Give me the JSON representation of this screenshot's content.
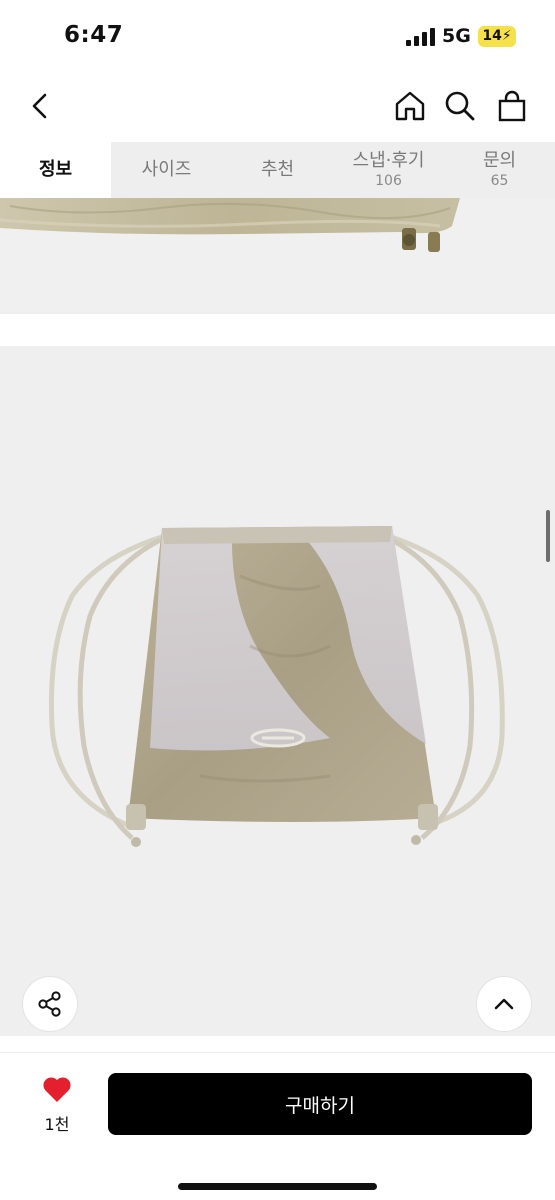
{
  "status_bar": {
    "time": "6:47",
    "network": "5G",
    "battery": "14"
  },
  "tabs": [
    {
      "label": "정보",
      "count": ""
    },
    {
      "label": "사이즈",
      "count": ""
    },
    {
      "label": "추천",
      "count": ""
    },
    {
      "label": "스냅·후기",
      "count": "106"
    },
    {
      "label": "문의",
      "count": "65"
    }
  ],
  "active_tab": "정보",
  "likes": {
    "count": "1천"
  },
  "buy_button": {
    "label": "구매하기"
  },
  "colors": {
    "accent": "#000000",
    "heart": "#e5202e",
    "battery": "#f5e14a",
    "tab_bg": "#eeeeee"
  },
  "icons": [
    "back-icon",
    "home-icon",
    "search-icon",
    "shopping-bag-icon",
    "share-icon",
    "chevron-up-icon",
    "heart-icon"
  ]
}
